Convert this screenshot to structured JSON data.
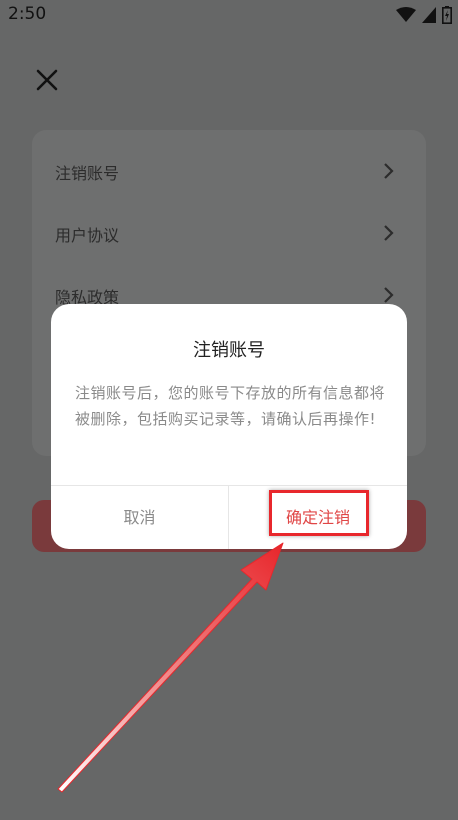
{
  "status_bar": {
    "time": "2:50"
  },
  "settings": {
    "items": [
      {
        "label": "注销账号"
      },
      {
        "label": "用户协议"
      },
      {
        "label": "隐私政策"
      }
    ]
  },
  "dialog": {
    "title": "注销账号",
    "message": "注销账号后，您的账号下存放的所有信息都将被删除，包括购买记录等，请确认后再操作!",
    "cancel_label": "取消",
    "confirm_label": "确定注销"
  },
  "colors": {
    "overlay": "#666767",
    "confirm_text": "#e04646",
    "annotation": "#e8272c"
  },
  "icons": {
    "close": "close-icon",
    "chevron": "chevron-right-icon",
    "wifi": "wifi-icon",
    "signal": "signal-icon",
    "battery": "battery-icon"
  }
}
